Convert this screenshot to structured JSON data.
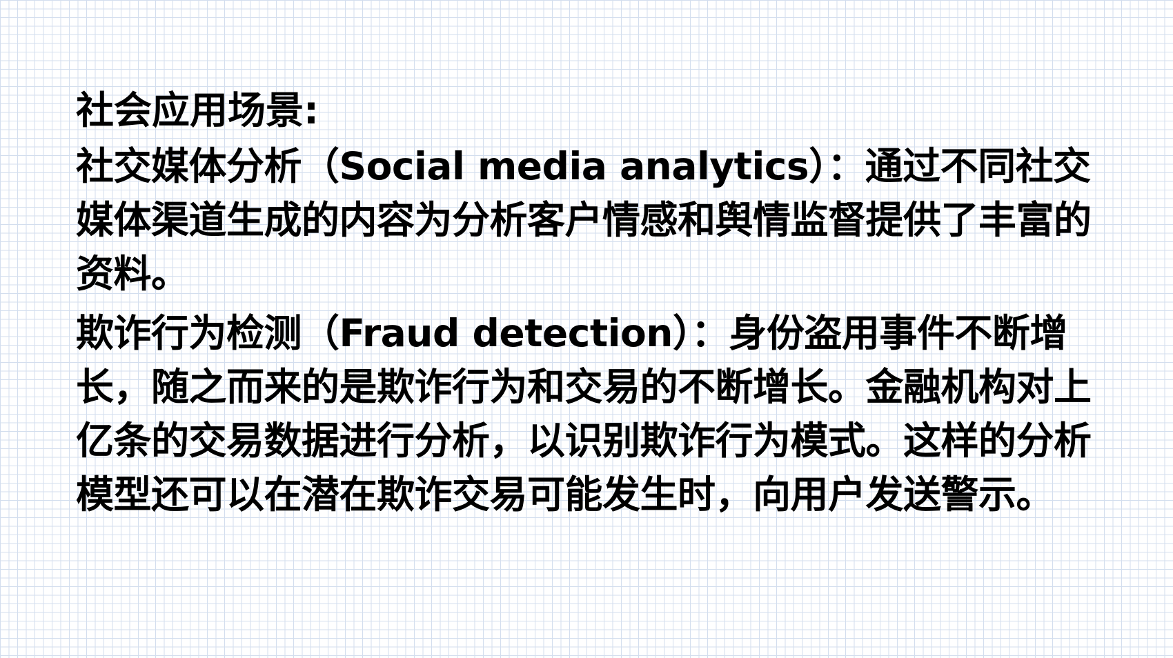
{
  "slide": {
    "heading": "社会应用场景:",
    "paragraphs": [
      "社交媒体分析（Social media analytics）：通过不同社交媒体渠道生成的内容为分析客户情感和舆情监督提供了丰富的资料。",
      "欺诈行为检测（Fraud detection）：身份盗用事件不断增长，随之而来的是欺诈行为和交易的不断增长。金融机构对上亿条的交易数据进行分析，以识别欺诈行为模式。这样的分析模型还可以在潜在欺诈交易可能发生时，向用户发送警示。"
    ]
  },
  "colors": {
    "text": "#000000",
    "background": "#ffffff",
    "grid": "#d3deee"
  }
}
